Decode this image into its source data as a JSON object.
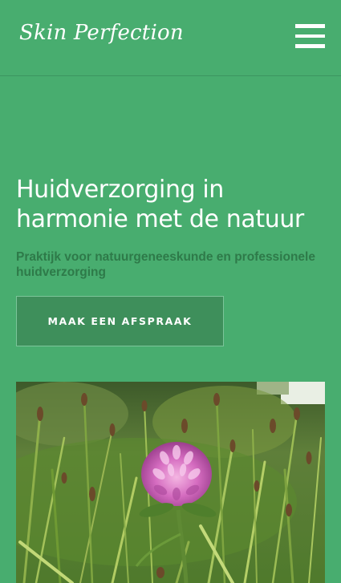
{
  "header": {
    "logo_text": "Skin Perfection",
    "menu_icon": "hamburger-menu-icon"
  },
  "hero": {
    "title": "Huidverzorging in harmonie met de natuur",
    "subtitle": "Praktijk voor natuurgeneeskunde en professionele huidverzorging",
    "cta_label": "MAAK EEN AFSPRAAK"
  },
  "image": {
    "subject": "clover-flower"
  },
  "colors": {
    "background": "#48ad6f",
    "cta_background": "#3e8f5b",
    "subtitle_text": "#2e7a49",
    "text": "#ffffff"
  }
}
